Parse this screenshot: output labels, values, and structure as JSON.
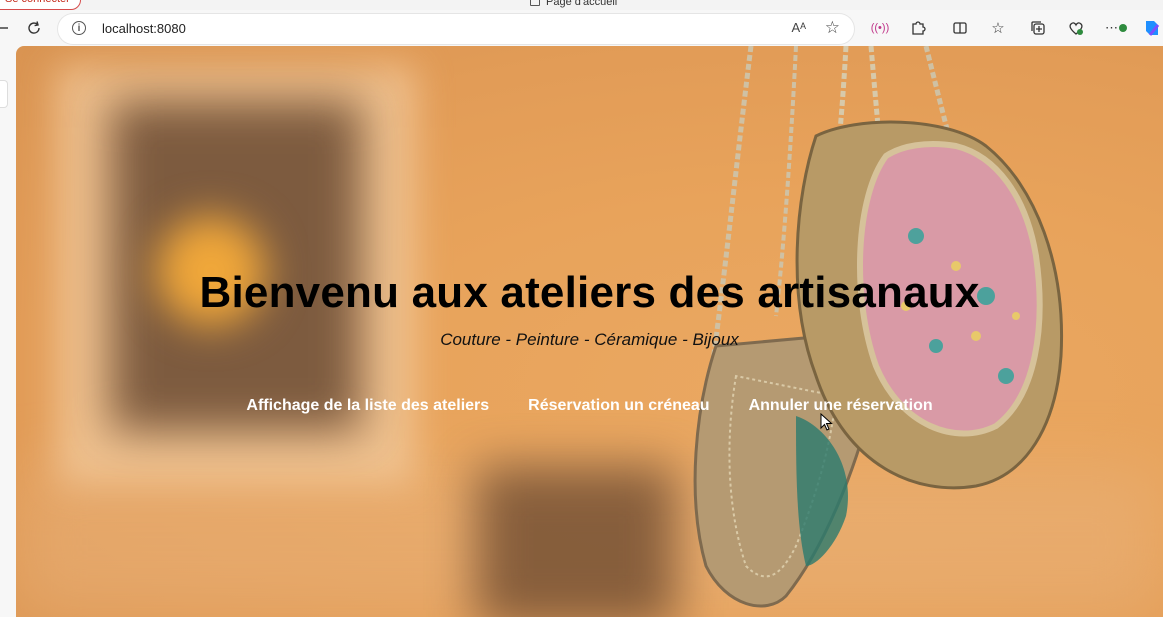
{
  "browser": {
    "signin_label": "Se connecter",
    "tab_title": "Page d'accueil",
    "url": "localhost:8080",
    "read_aloud_label": "Aᴬ"
  },
  "hero": {
    "title": "Bienvenu aux ateliers des artisanaux",
    "subtitle": "Couture - Peinture - Céramique - Bijoux",
    "links": [
      {
        "label": "Affichage de la liste des ateliers"
      },
      {
        "label": "Réservation un créneau"
      },
      {
        "label": "Annuler une réservation"
      }
    ]
  },
  "colors": {
    "background": "#e8a35b",
    "title": "#000000",
    "link": "#ffffff"
  }
}
